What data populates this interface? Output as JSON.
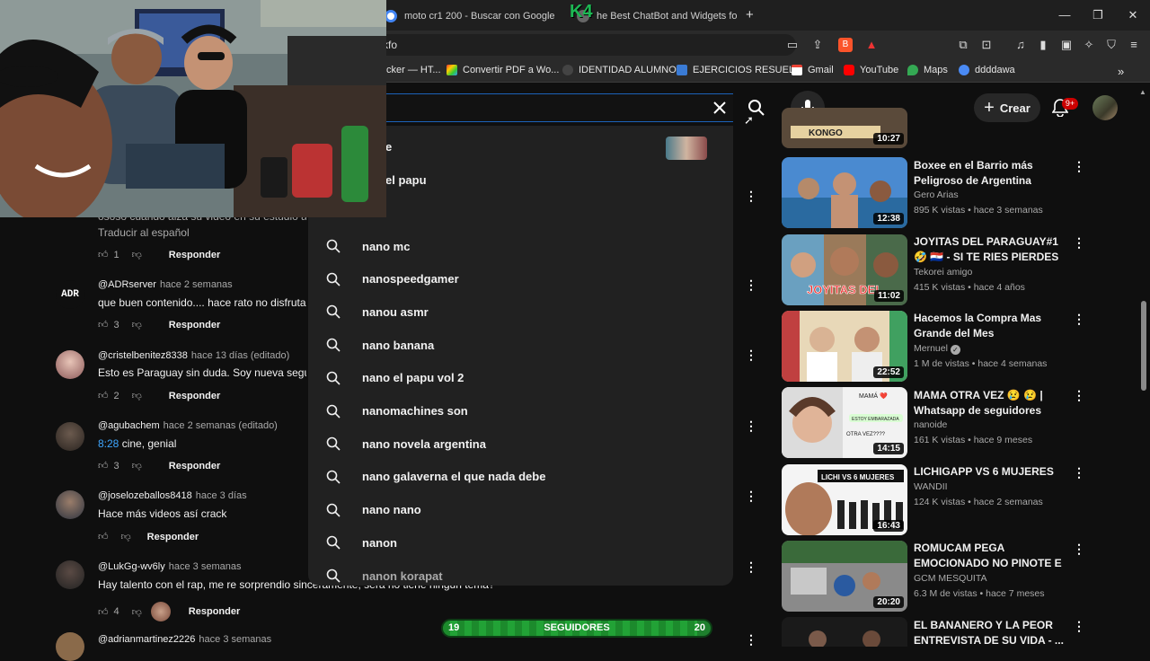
{
  "browser": {
    "tabs": [
      {
        "label": "moto cr1 200 - Buscar con Google"
      },
      {
        "label": "he Best ChatBot and Widgets for Ki"
      }
    ],
    "new_tab": "+",
    "address": "kfo",
    "bookmarks": [
      {
        "label": "cker — HT..."
      },
      {
        "label": "Convertir PDF a Wo..."
      },
      {
        "label": "IDENTIDAD ALUMNO"
      },
      {
        "label": "EJERCICIOS RESUEL..."
      },
      {
        "label": "Gmail"
      },
      {
        "label": "YouTube"
      },
      {
        "label": "Maps"
      },
      {
        "label": "ddddawa"
      }
    ],
    "ext_badge": "1",
    "overlay_logo": "K4"
  },
  "youtube": {
    "create_label": "Crear",
    "notif_badge": "9+"
  },
  "suggestions": {
    "partial_top": [
      "e",
      "el papu"
    ],
    "items": [
      "nano mc",
      "nanospeedgamer",
      "nanou asmr",
      "nano banana",
      "nano el papu vol 2",
      "nanomachines son",
      "nano novela argentina",
      "nano galaverna el que nada debe",
      "nano nano",
      "nanon",
      "nanon korapat"
    ]
  },
  "comments": [
    {
      "text": "Traducir al español",
      "likes": "1",
      "reply": "Responder",
      "partial": "ososo cuando aiza su video en su estudio a r"
    },
    {
      "author": "@ADRserver",
      "when": "hace 2 semanas",
      "text": "que buen contenido.... hace rato no disfrutab",
      "likes": "3",
      "reply": "Responder",
      "avatar_text": "ADR"
    },
    {
      "author": "@cristelbenitez8338",
      "when": "hace 13 días (editado)",
      "text": "Esto es Paraguay sin duda. Soy nueva seguid",
      "likes": "2",
      "reply": "Responder"
    },
    {
      "author": "@agubachem",
      "when": "hace 2 semanas (editado)",
      "time_link": "8:28",
      "text": "cine, genial",
      "likes": "3",
      "reply": "Responder"
    },
    {
      "author": "@joselozeballos8418",
      "when": "hace 3 días",
      "text": "Hace más videos así crack",
      "likes": "",
      "reply": "Responder"
    },
    {
      "author": "@LukGg-wv6ly",
      "when": "hace 3 semanas",
      "text": "Hay talento con el rap, me re sorprendio sinceramente, sera no tiene ningun tema?",
      "likes": "4",
      "reply": "Responder"
    },
    {
      "author": "@adrianmartinez2226",
      "when": "hace 3 semanas"
    }
  ],
  "videos": [
    {
      "title": "",
      "duration": "10:27",
      "thumb_text": "KONGO"
    },
    {
      "title": "Boxee en el Barrio más Peligroso de Argentina",
      "channel": "Gero Arias",
      "meta": "895 K vistas • hace 3 semanas",
      "duration": "12:38"
    },
    {
      "title": "JOYITAS DEL PARAGUAY#1 🤣 🇵🇾 - SI TE RIES PIERDES NIVEL...",
      "channel": "Tekorei amigo",
      "meta": "415 K vistas • hace 4 años",
      "duration": "11:02",
      "thumb_text": "JOYITAS DEL"
    },
    {
      "title": "Hacemos la Compra Mas Grande del Mes",
      "channel": "Mernuel",
      "verified": true,
      "meta": "1 M de vistas • hace 4 semanas",
      "duration": "22:52"
    },
    {
      "title": "MAMA OTRA VEZ 😢 😢 | Whatsapp de seguidores",
      "channel": "nanoide",
      "meta": "161 K vistas • hace 9 meses",
      "duration": "14:15",
      "thumb_texts": [
        "MAMÁ ❤️",
        "ESTOY EMBARAZADA",
        "OTRA VEZ????"
      ]
    },
    {
      "title": "LICHIGAPP VS 6 MUJERES",
      "channel": "WANDII",
      "meta": "124 K vistas • hace 2 semanas",
      "duration": "16:43",
      "thumb_text": "LICHI VS 6 MUJERES"
    },
    {
      "title": "ROMUCAM PEGA EMOCIONADO NO PINOTE E ...",
      "channel": "GCM MESQUITA",
      "meta": "6.3 M de vistas • hace 7 meses",
      "duration": "20:20"
    },
    {
      "title": "EL BANANERO Y LA PEOR ENTREVISTA DE SU VIDA - ..."
    }
  ],
  "followers": {
    "current": "19",
    "label": "SEGUIDORES",
    "goal": "20",
    "progress": 0.95
  }
}
